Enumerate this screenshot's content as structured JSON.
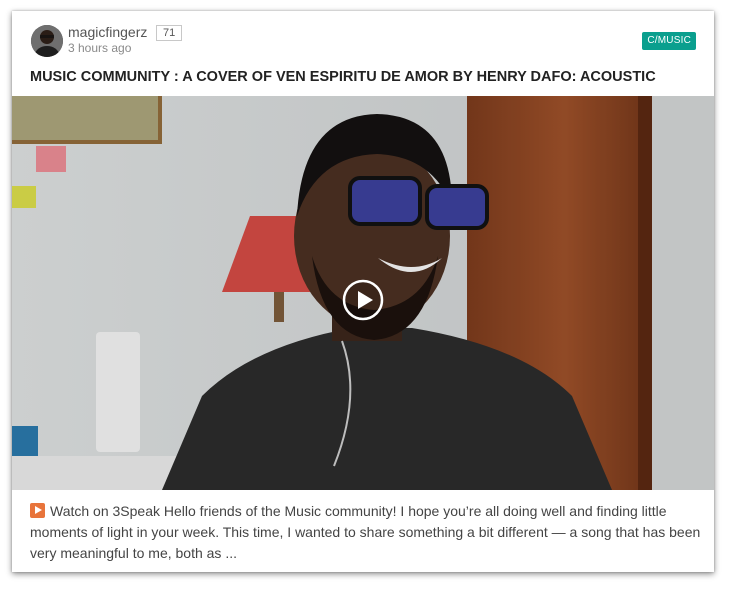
{
  "post": {
    "author": "magicfingerz",
    "reputation": "71",
    "time_ago": "3 hours ago",
    "community_tag": "C/MUSIC",
    "title": "MUSIC COMMUNITY : A COVER OF VEN ESPIRITU DE AMOR BY HENRY DAFO: ACOUSTIC",
    "summary": "Watch on 3Speak Hello friends of the Music community! I hope you’re all doing well and finding little moments of light in your week. This time, I wanted to share something a bit different — a song that has been very meaningful to me, both as ..."
  },
  "icons": {
    "play": "play-circle-icon",
    "summary_badge": "play-button-emoji-icon"
  },
  "colors": {
    "tag_bg": "#0a9f8e",
    "title": "#222222",
    "badge": "#e8743b"
  }
}
